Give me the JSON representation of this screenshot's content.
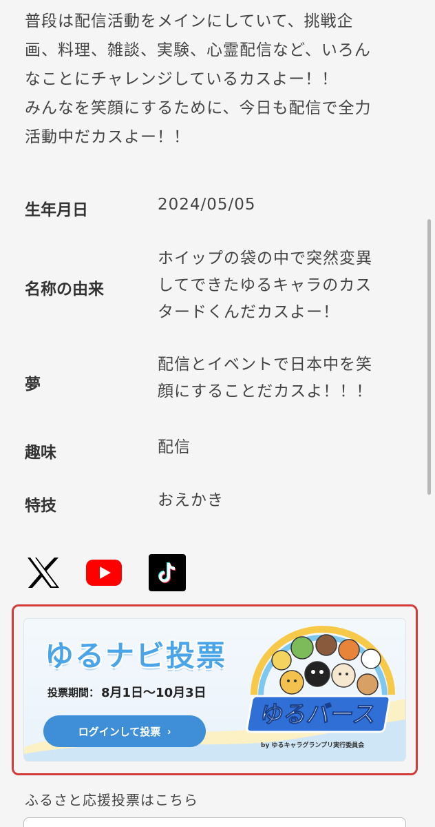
{
  "intro": {
    "lines": [
      "普段は配信活動をメインにしていて、挑戦企",
      "画、料理、雑談、実験、心霊配信など、いろん",
      "なことにチャレンジしているカスよー！！",
      "みんなを笑顔にするために、今日も配信で全力",
      "活動中だカスよー！！"
    ]
  },
  "profile": {
    "birthday": {
      "label": "生年月日",
      "value": "2024/05/05"
    },
    "name_origin": {
      "label": "名称の由来",
      "lines": [
        "ホイップの袋の中で突然変異",
        "してできたゆるキャラのカス",
        "タードくんだカスよー！"
      ]
    },
    "dream": {
      "label": "夢",
      "lines": [
        "配信とイベントで日本中を笑",
        "顔にすることだカスよ！！！"
      ]
    },
    "hobby": {
      "label": "趣味",
      "value": "配信"
    },
    "skill": {
      "label": "特技",
      "value": "おえかき"
    }
  },
  "social": {
    "icons": [
      "x-icon",
      "youtube-icon",
      "tiktok-icon"
    ],
    "colors": {
      "x": "#000000",
      "youtube": "#ff0000",
      "tiktok": "#000000"
    }
  },
  "vote_banner": {
    "title": "ゆるナビ投票",
    "period_label": "投票期間：",
    "period_value": "8月1日～10月3日",
    "login_button": "ログインして投票",
    "login_chevron": "›",
    "logo_text": "ゆるバース",
    "organizer": "by ゆるキャラグランプリ実行委員会",
    "frame_color": "#d43a3a",
    "accent": "#4aa4e8"
  },
  "furusato": {
    "label": "ふるさと応援投票はこちら"
  }
}
